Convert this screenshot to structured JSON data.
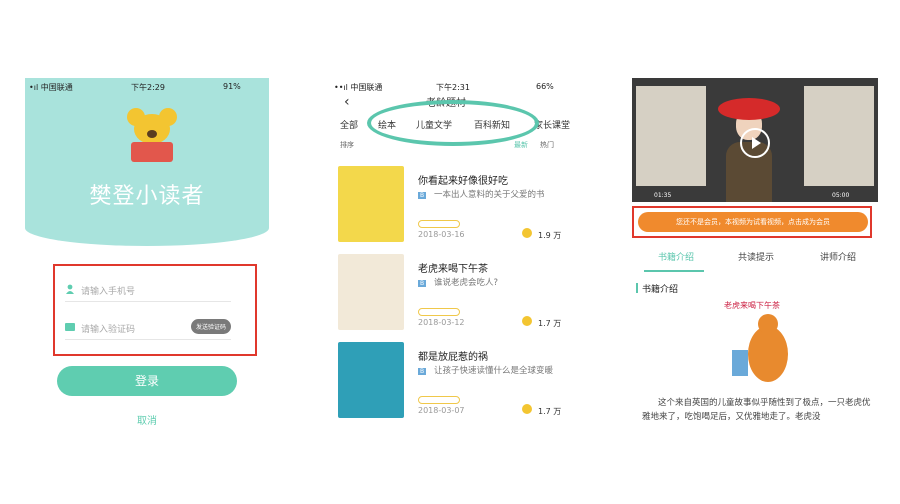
{
  "login": {
    "status": {
      "carrier": "•ıl 中国联通",
      "time": "下午2:29",
      "battery": "91%"
    },
    "brand": "樊登小读者",
    "phone_placeholder": "请输入手机号",
    "code_placeholder": "请输入验证码",
    "code_button": "发送验证码",
    "login_button": "登录",
    "cancel": "取消"
  },
  "list": {
    "status": {
      "carrier": "••ıl 中国联通",
      "time": "下午2:31",
      "battery": "66%"
    },
    "title": "老龄题材",
    "tabs": [
      "全部",
      "绘本",
      "儿童文学",
      "百科新知",
      "家长课堂"
    ],
    "sort_label": "排序",
    "sort_options": [
      "最新",
      "热门"
    ],
    "books": [
      {
        "title": "你看起来好像很好吃",
        "desc": "一本出人意料的关于父爱的书",
        "date": "2018-03-16",
        "count": "1.9 万"
      },
      {
        "title": "老虎来喝下午茶",
        "desc": "谁说老虎会吃人?",
        "date": "2018-03-12",
        "count": "1.7 万"
      },
      {
        "title": "都是放屁惹的祸",
        "desc": "让孩子快速读懂什么是全球变暖",
        "date": "2018-03-07",
        "count": "1.7 万"
      }
    ]
  },
  "detail": {
    "video_start": "01:35",
    "video_end": "05:00",
    "notice": "您还不是会员，本视频为试看视频，点击成为会员",
    "tabs": [
      "书籍介绍",
      "共读提示",
      "讲师介绍"
    ],
    "section": "书籍介绍",
    "illustration_title": "老虎来喝下午茶",
    "body": "这个来自英国的儿童故事似乎随性到了极点，一只老虎优雅地来了，吃饱喝足后，又优雅地走了。老虎没"
  }
}
